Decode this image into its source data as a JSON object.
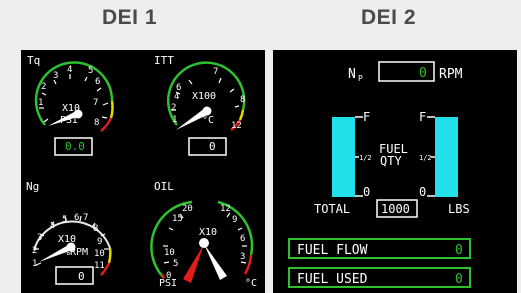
{
  "headers": {
    "dei1": "DEI 1",
    "dei2": "DEI 2"
  },
  "dei1": {
    "torque": {
      "label": "Tq",
      "unit": "PSI",
      "multiplier": "X10",
      "ticks": [
        "1",
        "2",
        "3",
        "4",
        "5",
        "6",
        "7",
        "8"
      ],
      "readout": "0.0"
    },
    "itt": {
      "label": "ITT",
      "unit": "°C",
      "multiplier": "X100",
      "ticks": [
        "1",
        "2",
        "4",
        "6",
        "7",
        "8",
        "12"
      ],
      "readout": "0"
    },
    "ng": {
      "label": "Ng",
      "unit": "%RPM",
      "multiplier": "X10",
      "ticks": [
        "1",
        "2",
        "3",
        "4",
        "5",
        "6",
        "7",
        "8",
        "9",
        "10",
        "11"
      ],
      "readout": "0"
    },
    "oil": {
      "label": "OIL",
      "multiplier": "X10",
      "psi_label": "PSI",
      "psi_ticks": [
        "0",
        "5",
        "10",
        "15",
        "20"
      ],
      "temp_label": "°C",
      "temp_ticks": [
        "3",
        "6",
        "9",
        "12"
      ]
    }
  },
  "dei2": {
    "np": {
      "label": "N",
      "sub": "P",
      "value": "0",
      "unit": "RPM"
    },
    "fuel_qty": {
      "label_line1": "FUEL",
      "label_line2": "QTY",
      "full": "F",
      "half": "1/2",
      "empty": "0",
      "total_label": "TOTAL",
      "total_value": "1000",
      "unit": "LBS"
    },
    "fuel_flow": {
      "label": "FUEL FLOW",
      "value": "0"
    },
    "fuel_used": {
      "label": "FUEL USED",
      "value": "0"
    }
  }
}
